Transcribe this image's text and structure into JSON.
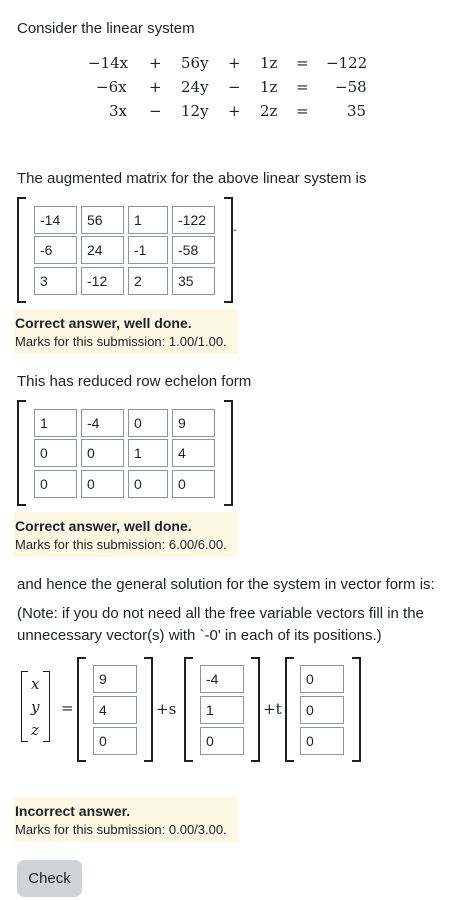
{
  "intro": "Consider the linear system",
  "system": {
    "rows": [
      {
        "a": "−14x",
        "op1": "+",
        "b": "56y",
        "op2": "+",
        "c": "1z",
        "eq": "=",
        "r": "−122"
      },
      {
        "a": "−6x",
        "op1": "+",
        "b": "24y",
        "op2": "−",
        "c": "1z",
        "eq": "=",
        "r": "−58"
      },
      {
        "a": "3x",
        "op1": "−",
        "b": "12y",
        "op2": "+",
        "c": "2z",
        "eq": "=",
        "r": "35"
      }
    ]
  },
  "augmented": {
    "prompt": "The augmented matrix for the above linear system is",
    "trailing": ".",
    "cells": [
      [
        "-14",
        "56",
        "1",
        "-122"
      ],
      [
        "-6",
        "24",
        "-1",
        "-58"
      ],
      [
        "3",
        "-12",
        "2",
        "35"
      ]
    ],
    "feedback": {
      "heading": "Correct answer, well done.",
      "marks": "Marks for this submission: 1.00/1.00."
    }
  },
  "rref": {
    "prompt": "This has reduced row echelon form",
    "cells": [
      [
        "1",
        "-4",
        "0",
        "9"
      ],
      [
        "0",
        "0",
        "1",
        "4"
      ],
      [
        "0",
        "0",
        "0",
        "0"
      ]
    ],
    "feedback": {
      "heading": "Correct answer, well done.",
      "marks": "Marks for this submission: 6.00/6.00."
    }
  },
  "solution": {
    "prompt": "and hence the general solution for the system in vector form is:",
    "note_line1": "(Note: if you do not need all the free variable vectors fill in the",
    "note_line2": "unnecessary vector(s) with `-0' in each of its positions.)",
    "vars": [
      "x",
      "y",
      "z"
    ],
    "equals": "=",
    "v0": [
      "9",
      "4",
      "0"
    ],
    "plus_s": "+s",
    "v1": [
      "-4",
      "1",
      "0"
    ],
    "plus_t": "+t",
    "v2": [
      "0",
      "0",
      "0"
    ],
    "feedback": {
      "heading": "Incorrect answer.",
      "marks": "Marks for this submission: 0.00/3.00."
    }
  },
  "check_button": "Check"
}
